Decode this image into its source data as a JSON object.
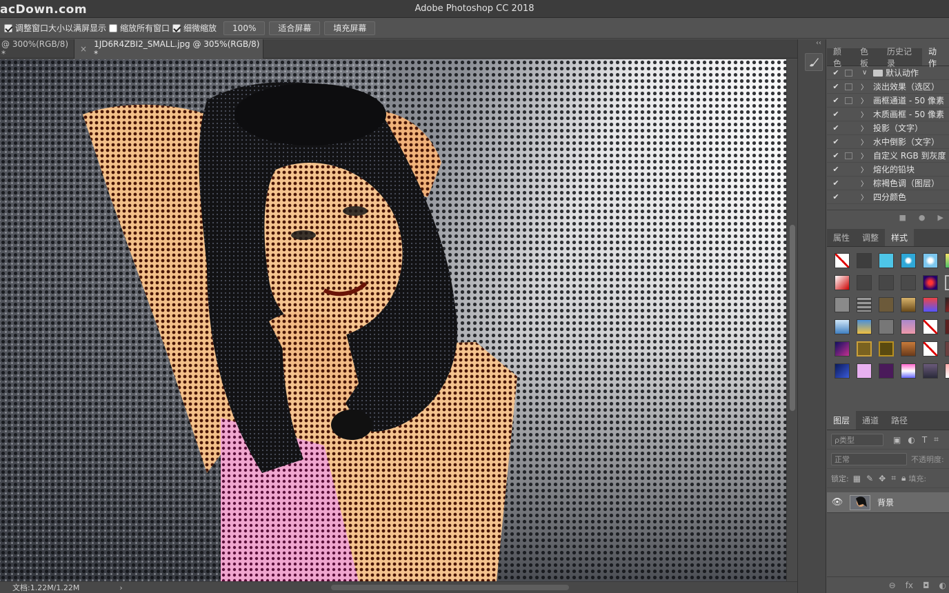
{
  "titlebar": {
    "watermark": "acDown.com",
    "title": "Adobe Photoshop CC 2018"
  },
  "options": {
    "resize_windows_label": "调整窗口大小以满屏显示",
    "zoom_all_label": "缩放所有窗口",
    "scrubby_zoom_label": "细微缩放",
    "zoom_value": "100%",
    "fit_screen_label": "适合屏幕",
    "fill_screen_label": "填充屏幕"
  },
  "tabs": [
    {
      "label": "@ 300%(RGB/8) *"
    },
    {
      "label": "1JD6R4ZBI2_SMALL.jpg @ 305%(RGB/8) *",
      "close": "×"
    }
  ],
  "status": {
    "doc": "文档:1.22M/1.22M",
    "arrow": "›"
  },
  "panels": {
    "top_tabs": [
      "颜色",
      "色板",
      "历史记录",
      "动作"
    ],
    "actions": {
      "set_name": "默认动作",
      "items": [
        "淡出效果（选区）",
        "画框通道 - 50 像素",
        "木质画框 - 50 像素",
        "投影（文字）",
        "水中倒影（文字）",
        "自定义 RGB 到灰度",
        "熔化的铅块",
        "棕褐色调（图层）",
        "四分颜色"
      ],
      "footer_icons": [
        "■",
        "●",
        "▶"
      ]
    },
    "mid_tabs": [
      "属性",
      "调整",
      "样式"
    ],
    "layers_tabs": [
      "图层",
      "通道",
      "路径"
    ],
    "layers": {
      "filter_label": "ρ类型",
      "blend_mode": "正常",
      "opacity_label": "不透明度:",
      "lock_label": "锁定:",
      "fill_label": "填充:",
      "layer_name": "背景",
      "footer_icons": [
        "⊖",
        "fx",
        "◘",
        "◐"
      ]
    }
  },
  "colors": {
    "bg": "#535353",
    "title_bg": "#3c3c3c",
    "selected_layer": "#6a6a6a"
  }
}
